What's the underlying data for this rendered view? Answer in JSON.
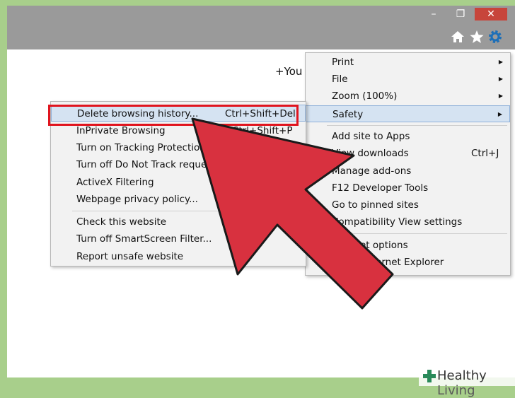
{
  "browser": {
    "window_controls": [
      "minimize-icon",
      "maximize-icon",
      "close-icon"
    ],
    "toolbar_icons": [
      "home-icon",
      "star-icon",
      "gear-icon"
    ],
    "page_text": "+You"
  },
  "tools_menu": {
    "items": [
      {
        "label": "Print",
        "submenu": true
      },
      {
        "label": "File",
        "submenu": true
      },
      {
        "label": "Zoom (100%)",
        "submenu": true
      },
      {
        "label": "Safety",
        "submenu": true,
        "highlighted": true
      },
      {
        "label": "Add site to Apps"
      },
      {
        "label": "View downloads",
        "shortcut": "Ctrl+J"
      },
      {
        "label": "Manage add-ons"
      },
      {
        "label": "F12 Developer Tools"
      },
      {
        "label": "Go to pinned sites"
      },
      {
        "label": "Compatibility View settings"
      },
      {
        "label": "Internet options"
      },
      {
        "label": "About Internet Explorer"
      }
    ]
  },
  "safety_menu": {
    "items": [
      {
        "label": "Delete browsing history...",
        "shortcut": "Ctrl+Shift+Del",
        "highlighted": true
      },
      {
        "label": "InPrivate Browsing",
        "shortcut": "Ctrl+Shift+P"
      },
      {
        "label": "Turn on Tracking Protection"
      },
      {
        "label": "Turn off Do Not Track requests"
      },
      {
        "label": "ActiveX Filtering"
      },
      {
        "label": "Webpage privacy policy..."
      },
      {
        "label": "Check this website"
      },
      {
        "label": "Turn off SmartScreen Filter..."
      },
      {
        "label": "Report unsafe website"
      }
    ]
  },
  "watermark": {
    "brand": "Healthy",
    "brand2": "Living",
    "icon": "plus-logo-icon"
  },
  "colors": {
    "annotation_arrow": "#d8313f",
    "highlight_box": "#e0141e",
    "watermark_plus": "#2a8a5a"
  }
}
